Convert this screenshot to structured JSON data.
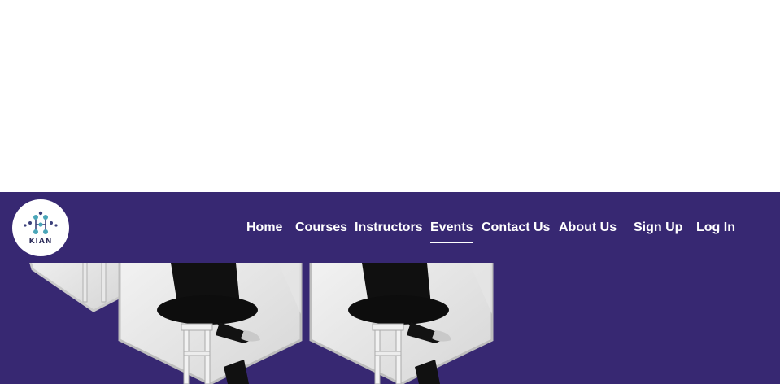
{
  "brand": {
    "logo_text": "KIAN"
  },
  "nav": {
    "items": [
      {
        "label": "Home",
        "active": false
      },
      {
        "label": "Courses",
        "active": false
      },
      {
        "label": "Instructors",
        "active": false
      },
      {
        "label": "Events",
        "active": true
      },
      {
        "label": "Contact Us",
        "active": false
      },
      {
        "label": "About Us",
        "active": false
      }
    ],
    "sign_up": "Sign Up",
    "log_in": "Log In"
  },
  "colors": {
    "brand_purple": "#372872",
    "nav_text": "#ffffff",
    "page_bg": "#ffffff"
  }
}
